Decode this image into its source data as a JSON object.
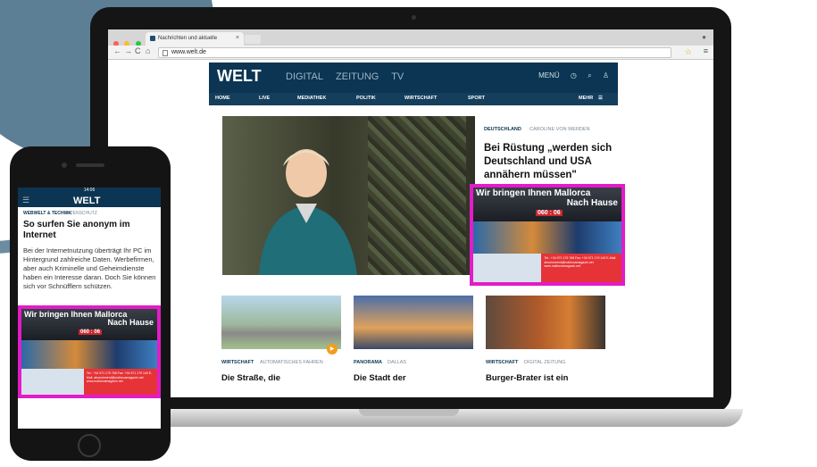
{
  "browser": {
    "tab_title": "Nachrichten und aktuelle",
    "url": "www.welt.de"
  },
  "site": {
    "logo": "WELT",
    "sections": [
      "DIGITAL",
      "ZEITUNG",
      "TV"
    ],
    "right_label": "MENÜ",
    "nav": [
      "HOME",
      "LIVE",
      "MEDIATHEK",
      "POLITIK",
      "WIRTSCHAFT",
      "SPORT"
    ],
    "nav_more": "MEHR"
  },
  "lead": {
    "kicker": "DEUTSCHLAND",
    "kicker_sub": "CAROLINE VON WERDEN",
    "headline": "Bei Rüstung „werden sich Deutschland und USA annähern müssen\""
  },
  "ad": {
    "title": "Wir bringen Ihnen Mallorca",
    "subtitle": "Nach Hause",
    "tag": "zurück nach Mallorca mit uns",
    "counter": "060 : 06",
    "small_print": "Tel.: +34 971 179 768 Fax: +34 971 179 149 E-Mail: abonnement@mallorcamagazin.net www.mallorcamagazin.net"
  },
  "teasers": [
    {
      "kicker": "WIRTSCHAFT",
      "kicker_sub": "AUTOMATISCHES FAHREN",
      "title": "Die Straße, die"
    },
    {
      "kicker": "PANORAMA",
      "kicker_sub": "DALLAS",
      "title": "Die Stadt der"
    },
    {
      "kicker": "WIRTSCHAFT",
      "kicker_sub": "DIGITAL ZEITUNG",
      "title": "Burger-Brater ist ein"
    }
  ],
  "phone": {
    "time": "14:06",
    "logo": "WELT",
    "kicker": "WEBWELT & TECHNIK",
    "kicker_sub": "DATENSCHUTZ",
    "headline": "So surfen Sie anonym im Internet",
    "body": "Bei der Internetnutzung überträgt Ihr PC im Hintergrund zahlreiche Daten. Werbefirmen, aber auch Kriminelle und Geheimdienste haben ein Interesse daran. Doch Sie können sich vor Schnüfflern schützen."
  }
}
